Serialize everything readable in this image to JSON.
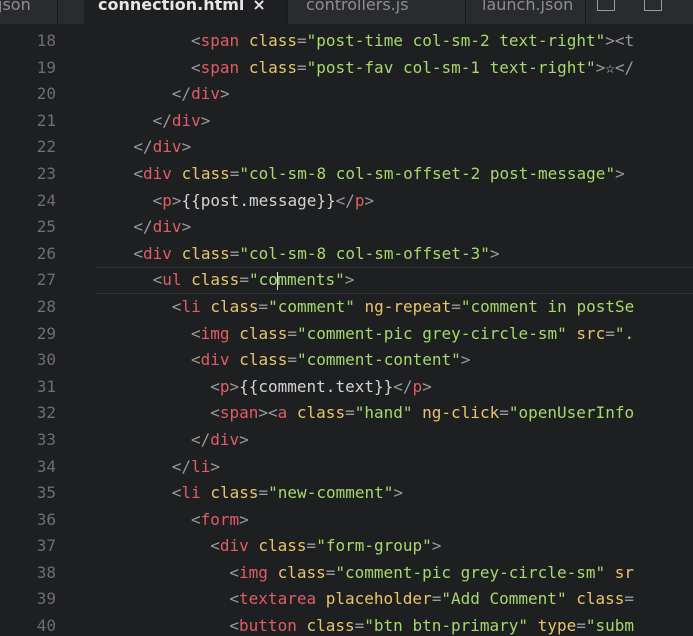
{
  "colors": {
    "background": "#1e1f21",
    "tag": "#e05d66",
    "attribute": "#e8c56a",
    "string": "#a6d96b",
    "punctuation": "#9a9a9a",
    "line_number": "#6e6e70"
  },
  "tabs": [
    {
      "label": "json",
      "active": false,
      "close": ""
    },
    {
      "label": "connection.html",
      "active": true,
      "close": "×"
    },
    {
      "label": "controllers.js",
      "active": false,
      "close": ""
    },
    {
      "label": "launch.json",
      "active": false,
      "close": ""
    }
  ],
  "toolbar_icons": [
    "open-changes-icon",
    "split-editor-icon"
  ],
  "cursor": {
    "line": 27,
    "char_index": 13
  },
  "lines": [
    {
      "num": "18",
      "indent": 10,
      "tokens": [
        [
          "p",
          "<"
        ],
        [
          "t",
          "span"
        ],
        [
          "p",
          " "
        ],
        [
          "a",
          "class"
        ],
        [
          "p",
          "="
        ],
        [
          "s",
          "\"post-time col-sm-2 text-right\""
        ],
        [
          "p",
          ">"
        ],
        [
          "p",
          "<t"
        ]
      ]
    },
    {
      "num": "19",
      "indent": 10,
      "tokens": [
        [
          "p",
          "<"
        ],
        [
          "t",
          "span"
        ],
        [
          "p",
          " "
        ],
        [
          "a",
          "class"
        ],
        [
          "p",
          "="
        ],
        [
          "s",
          "\"post-fav col-sm-1 text-right\""
        ],
        [
          "p",
          ">"
        ],
        [
          "x",
          "☆"
        ],
        [
          "p",
          "</"
        ]
      ]
    },
    {
      "num": "20",
      "indent": 8,
      "tokens": [
        [
          "p",
          "</"
        ],
        [
          "t",
          "div"
        ],
        [
          "p",
          ">"
        ]
      ]
    },
    {
      "num": "21",
      "indent": 6,
      "tokens": [
        [
          "p",
          "</"
        ],
        [
          "t",
          "div"
        ],
        [
          "p",
          ">"
        ]
      ]
    },
    {
      "num": "22",
      "indent": 4,
      "tokens": [
        [
          "p",
          "</"
        ],
        [
          "t",
          "div"
        ],
        [
          "p",
          ">"
        ]
      ]
    },
    {
      "num": "23",
      "indent": 4,
      "tokens": [
        [
          "p",
          "<"
        ],
        [
          "t",
          "div"
        ],
        [
          "p",
          " "
        ],
        [
          "a",
          "class"
        ],
        [
          "p",
          "="
        ],
        [
          "s",
          "\"col-sm-8 col-sm-offset-2 post-message\""
        ],
        [
          "p",
          ">"
        ]
      ]
    },
    {
      "num": "24",
      "indent": 6,
      "tokens": [
        [
          "p",
          "<"
        ],
        [
          "t",
          "p"
        ],
        [
          "p",
          ">"
        ],
        [
          "x",
          "{{post.message}}"
        ],
        [
          "p",
          "</"
        ],
        [
          "t",
          "p"
        ],
        [
          "p",
          ">"
        ]
      ]
    },
    {
      "num": "25",
      "indent": 4,
      "tokens": [
        [
          "p",
          "</"
        ],
        [
          "t",
          "div"
        ],
        [
          "p",
          ">"
        ]
      ]
    },
    {
      "num": "26",
      "indent": 4,
      "tokens": [
        [
          "p",
          "<"
        ],
        [
          "t",
          "div"
        ],
        [
          "p",
          " "
        ],
        [
          "a",
          "class"
        ],
        [
          "p",
          "="
        ],
        [
          "s",
          "\"col-sm-8 col-sm-offset-3\""
        ],
        [
          "p",
          ">"
        ]
      ]
    },
    {
      "num": "27",
      "indent": 6,
      "tokens": [
        [
          "p",
          "<"
        ],
        [
          "t",
          "ul"
        ],
        [
          "p",
          " "
        ],
        [
          "a",
          "class"
        ],
        [
          "p",
          "="
        ],
        [
          "s",
          "\"comments\""
        ],
        [
          "p",
          ">"
        ]
      ]
    },
    {
      "num": "28",
      "indent": 8,
      "tokens": [
        [
          "p",
          "<"
        ],
        [
          "t",
          "li"
        ],
        [
          "p",
          " "
        ],
        [
          "a",
          "class"
        ],
        [
          "p",
          "="
        ],
        [
          "s",
          "\"comment\""
        ],
        [
          "p",
          " "
        ],
        [
          "a",
          "ng-repeat"
        ],
        [
          "p",
          "="
        ],
        [
          "s",
          "\"comment in postSe"
        ]
      ]
    },
    {
      "num": "29",
      "indent": 10,
      "tokens": [
        [
          "p",
          "<"
        ],
        [
          "t",
          "img"
        ],
        [
          "p",
          " "
        ],
        [
          "a",
          "class"
        ],
        [
          "p",
          "="
        ],
        [
          "s",
          "\"comment-pic grey-circle-sm\""
        ],
        [
          "p",
          " "
        ],
        [
          "a",
          "src"
        ],
        [
          "p",
          "="
        ],
        [
          "s",
          "\"."
        ]
      ]
    },
    {
      "num": "30",
      "indent": 10,
      "tokens": [
        [
          "p",
          "<"
        ],
        [
          "t",
          "div"
        ],
        [
          "p",
          " "
        ],
        [
          "a",
          "class"
        ],
        [
          "p",
          "="
        ],
        [
          "s",
          "\"comment-content\""
        ],
        [
          "p",
          ">"
        ]
      ]
    },
    {
      "num": "31",
      "indent": 12,
      "tokens": [
        [
          "p",
          "<"
        ],
        [
          "t",
          "p"
        ],
        [
          "p",
          ">"
        ],
        [
          "x",
          "{{comment.text}}"
        ],
        [
          "p",
          "</"
        ],
        [
          "t",
          "p"
        ],
        [
          "p",
          ">"
        ]
      ]
    },
    {
      "num": "32",
      "indent": 12,
      "tokens": [
        [
          "p",
          "<"
        ],
        [
          "t",
          "span"
        ],
        [
          "p",
          "><"
        ],
        [
          "t",
          "a"
        ],
        [
          "p",
          " "
        ],
        [
          "a",
          "class"
        ],
        [
          "p",
          "="
        ],
        [
          "s",
          "\"hand\""
        ],
        [
          "p",
          " "
        ],
        [
          "a",
          "ng-click"
        ],
        [
          "p",
          "="
        ],
        [
          "s",
          "\"openUserInfo"
        ]
      ]
    },
    {
      "num": "33",
      "indent": 10,
      "tokens": [
        [
          "p",
          "</"
        ],
        [
          "t",
          "div"
        ],
        [
          "p",
          ">"
        ]
      ]
    },
    {
      "num": "34",
      "indent": 8,
      "tokens": [
        [
          "p",
          "</"
        ],
        [
          "t",
          "li"
        ],
        [
          "p",
          ">"
        ]
      ]
    },
    {
      "num": "35",
      "indent": 8,
      "tokens": [
        [
          "p",
          "<"
        ],
        [
          "t",
          "li"
        ],
        [
          "p",
          " "
        ],
        [
          "a",
          "class"
        ],
        [
          "p",
          "="
        ],
        [
          "s",
          "\"new-comment\""
        ],
        [
          "p",
          ">"
        ]
      ]
    },
    {
      "num": "36",
      "indent": 10,
      "tokens": [
        [
          "p",
          "<"
        ],
        [
          "t",
          "form"
        ],
        [
          "p",
          ">"
        ]
      ]
    },
    {
      "num": "37",
      "indent": 12,
      "tokens": [
        [
          "p",
          "<"
        ],
        [
          "t",
          "div"
        ],
        [
          "p",
          " "
        ],
        [
          "a",
          "class"
        ],
        [
          "p",
          "="
        ],
        [
          "s",
          "\"form-group\""
        ],
        [
          "p",
          ">"
        ]
      ]
    },
    {
      "num": "38",
      "indent": 14,
      "tokens": [
        [
          "p",
          "<"
        ],
        [
          "t",
          "img"
        ],
        [
          "p",
          " "
        ],
        [
          "a",
          "class"
        ],
        [
          "p",
          "="
        ],
        [
          "s",
          "\"comment-pic grey-circle-sm\""
        ],
        [
          "p",
          " "
        ],
        [
          "a",
          "sr"
        ]
      ]
    },
    {
      "num": "39",
      "indent": 14,
      "tokens": [
        [
          "p",
          "<"
        ],
        [
          "t",
          "textarea"
        ],
        [
          "p",
          " "
        ],
        [
          "a",
          "placeholder"
        ],
        [
          "p",
          "="
        ],
        [
          "s",
          "\"Add Comment\""
        ],
        [
          "p",
          " "
        ],
        [
          "a",
          "class"
        ],
        [
          "p",
          "="
        ]
      ]
    },
    {
      "num": "40",
      "indent": 14,
      "tokens": [
        [
          "p",
          "<"
        ],
        [
          "t",
          "button"
        ],
        [
          "p",
          " "
        ],
        [
          "a",
          "class"
        ],
        [
          "p",
          "="
        ],
        [
          "s",
          "\"btn btn-primary\""
        ],
        [
          "p",
          " "
        ],
        [
          "a",
          "type"
        ],
        [
          "p",
          "="
        ],
        [
          "s",
          "\"subm"
        ]
      ]
    }
  ]
}
